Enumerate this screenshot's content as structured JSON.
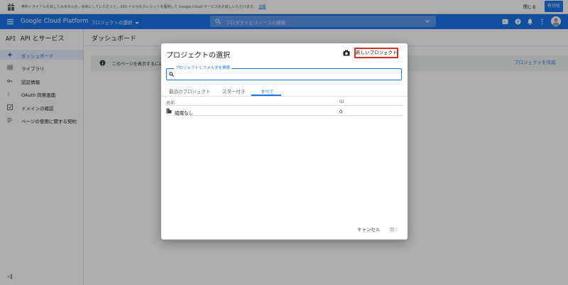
{
  "promo": {
    "text": "無料トライアルを試してみませんか。有効にしていただくと、300 ドル分のクレジットを獲得して Google Cloud サービスをお試しいただけます。",
    "link": "詳細",
    "dismiss": "閉じる",
    "activate": "有効化"
  },
  "topbar": {
    "brand": "Google Cloud Platform",
    "project_selector": "プロジェクトの選択",
    "search_placeholder": "プロダクトとリソースの検索"
  },
  "sidebar": {
    "api_logo": "API",
    "title": "API とサービス",
    "items": [
      {
        "label": "ダッシュボード",
        "icon": "dashboard-icon",
        "active": true
      },
      {
        "label": "ライブラリ",
        "icon": "library-icon",
        "active": false
      },
      {
        "label": "認証情報",
        "icon": "key-icon",
        "active": false
      },
      {
        "label": "OAuth 同意画面",
        "icon": "oauth-icon",
        "active": false
      },
      {
        "label": "ドメインの確認",
        "icon": "domain-check-icon",
        "active": false
      },
      {
        "label": "ページの使用に関する契約",
        "icon": "agreement-icon",
        "active": false
      }
    ],
    "collapse": "◁|"
  },
  "main": {
    "title": "ダッシュボード",
    "info_text": "このページを表示するには",
    "create_project": "プロジェクトを作成"
  },
  "dialog": {
    "title": "プロジェクトの選択",
    "new_project": "新しいプロジェクト",
    "search_label": "プロジェクトとフォルダを検索",
    "search_value": "",
    "tabs": [
      "最近のプロジェクト",
      "スター付き",
      "すべて"
    ],
    "active_tab": "すべて",
    "table": {
      "headers": [
        "名前",
        "ID"
      ],
      "rows": [
        {
          "name": "組織なし",
          "id": "0"
        }
      ]
    },
    "cancel": "キャンセル",
    "open": "開く"
  },
  "colors": {
    "brand_blue": "#1a73e8",
    "highlight_red": "#d93025"
  }
}
